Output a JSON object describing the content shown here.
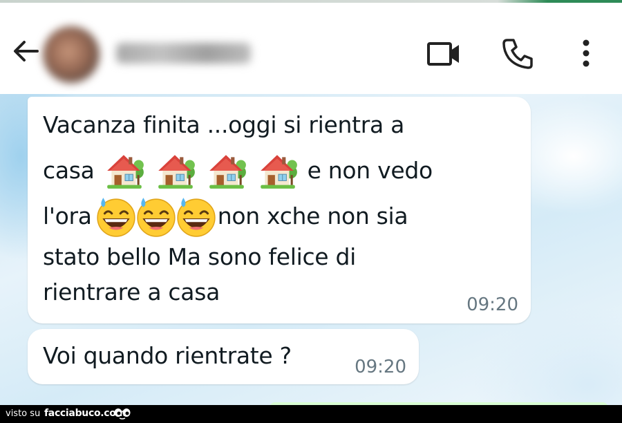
{
  "header": {
    "contact_name": "xxxxxxxxxxxx",
    "back_icon": "arrow-left-icon",
    "video_icon": "video-camera-icon",
    "call_icon": "phone-icon",
    "menu_icon": "more-vertical-icon"
  },
  "messages": [
    {
      "lines": [
        [
          "Vacanza finita ...oggi si rientra a"
        ],
        [
          "casa",
          "e non vedo"
        ],
        [
          "l'ora",
          "non xche non sia"
        ],
        [
          "stato bello Ma sono felice di"
        ],
        [
          "rientrare a casa"
        ]
      ],
      "emoji_groups": [
        {
          "name": "house-with-garden-emoji",
          "count": 4
        },
        {
          "name": "grinning-face-with-sweat-emoji",
          "count": 3
        }
      ],
      "time": "09:20"
    },
    {
      "text": "Voi quando rientrate ?",
      "time": "09:20"
    }
  ],
  "watermark": {
    "prefix": "visto su",
    "brand": "facciabuco.com"
  },
  "colors": {
    "bubble": "#ffffff",
    "text": "#111b21",
    "timestamp": "#667781",
    "outgoing_bubble": "#d9fdd3"
  }
}
